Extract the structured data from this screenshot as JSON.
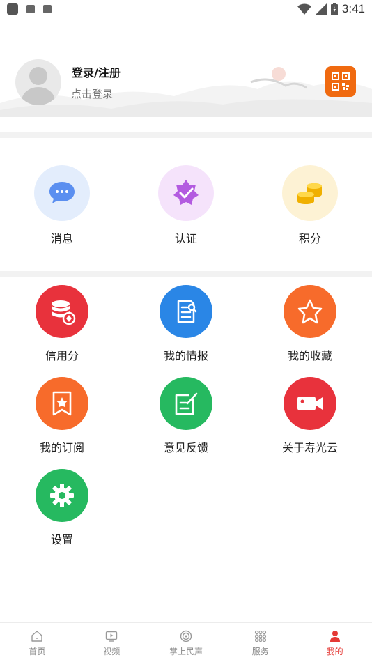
{
  "status_bar": {
    "time": "3:41"
  },
  "profile": {
    "title": "登录/注册",
    "subtitle": "点击登录"
  },
  "quick": [
    {
      "label": "消息",
      "icon": "message-icon"
    },
    {
      "label": "认证",
      "icon": "certify-icon"
    },
    {
      "label": "积分",
      "icon": "coins-icon"
    }
  ],
  "grid": [
    {
      "label": "信用分",
      "icon": "credit-icon"
    },
    {
      "label": "我的情报",
      "icon": "report-icon"
    },
    {
      "label": "我的收藏",
      "icon": "star-icon"
    },
    {
      "label": "我的订阅",
      "icon": "bookmark-icon"
    },
    {
      "label": "意见反馈",
      "icon": "feedback-icon"
    },
    {
      "label": "关于寿光云",
      "icon": "video-icon"
    },
    {
      "label": "设置",
      "icon": "gear-icon"
    }
  ],
  "nav": [
    {
      "label": "首页",
      "icon": "home-icon"
    },
    {
      "label": "视频",
      "icon": "play-icon"
    },
    {
      "label": "掌上民声",
      "icon": "voice-icon"
    },
    {
      "label": "服务",
      "icon": "grid-dots-icon"
    },
    {
      "label": "我的",
      "icon": "user-icon"
    }
  ],
  "colors": {
    "accent": "#e53935",
    "qr_bg": "#f06a10",
    "credit": "#e8323c",
    "report": "#2a86e6",
    "star": "#f76b2b",
    "bookmark": "#f76b2b",
    "feedback": "#26b960",
    "video": "#e8323c",
    "settings": "#26b960"
  }
}
